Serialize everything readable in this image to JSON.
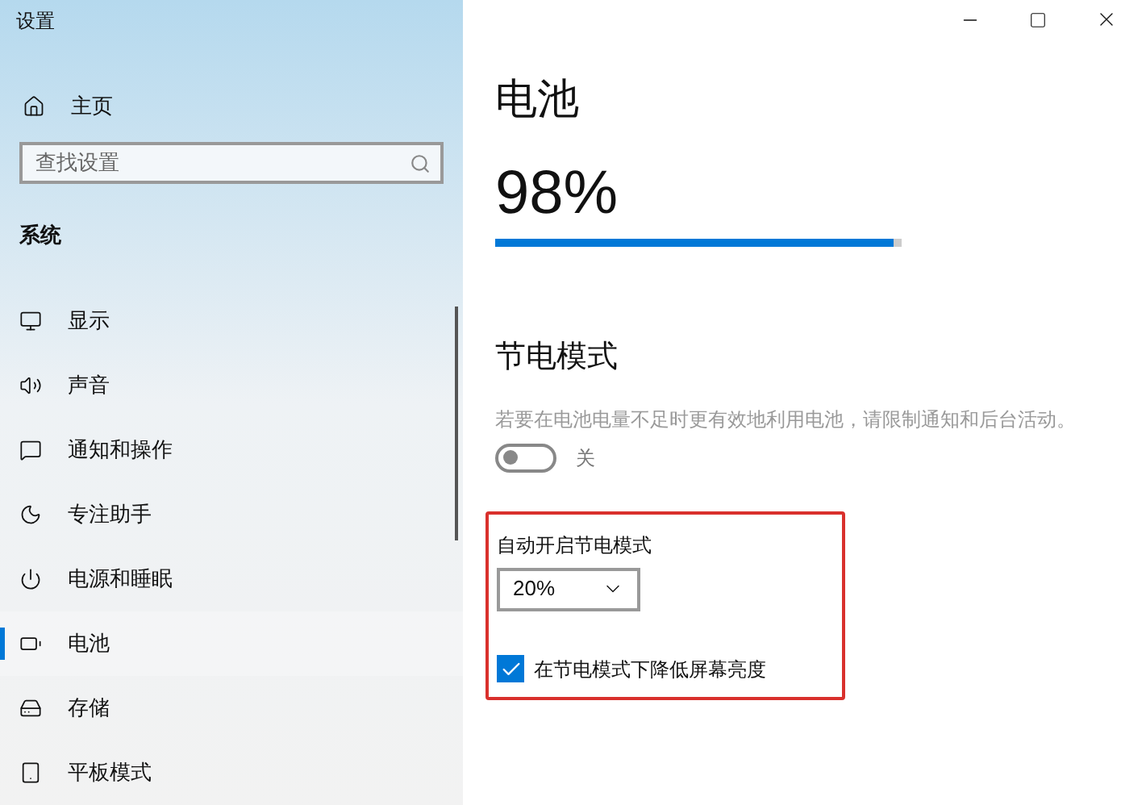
{
  "window": {
    "title": "设置"
  },
  "sidebar": {
    "home": "主页",
    "search": {
      "placeholder": "查找设置"
    },
    "section": "系统",
    "items": [
      {
        "label": "显示",
        "selected": false
      },
      {
        "label": "声音",
        "selected": false
      },
      {
        "label": "通知和操作",
        "selected": false
      },
      {
        "label": "专注助手",
        "selected": false
      },
      {
        "label": "电源和睡眠",
        "selected": false
      },
      {
        "label": "电池",
        "selected": true
      },
      {
        "label": "存储",
        "selected": false
      },
      {
        "label": "平板模式",
        "selected": false
      }
    ]
  },
  "main": {
    "title": "电池",
    "percent": "98%",
    "level": 0.98,
    "saver": {
      "heading": "节电模式",
      "description": "若要在电池电量不足时更有效地利用电池，请限制通知和后台活动。",
      "on": false,
      "state_label": "关",
      "auto_label": "自动开启节电模式",
      "threshold": "20%",
      "dim": {
        "label": "在节电模式下降低屏幕亮度",
        "checked": true
      }
    }
  }
}
